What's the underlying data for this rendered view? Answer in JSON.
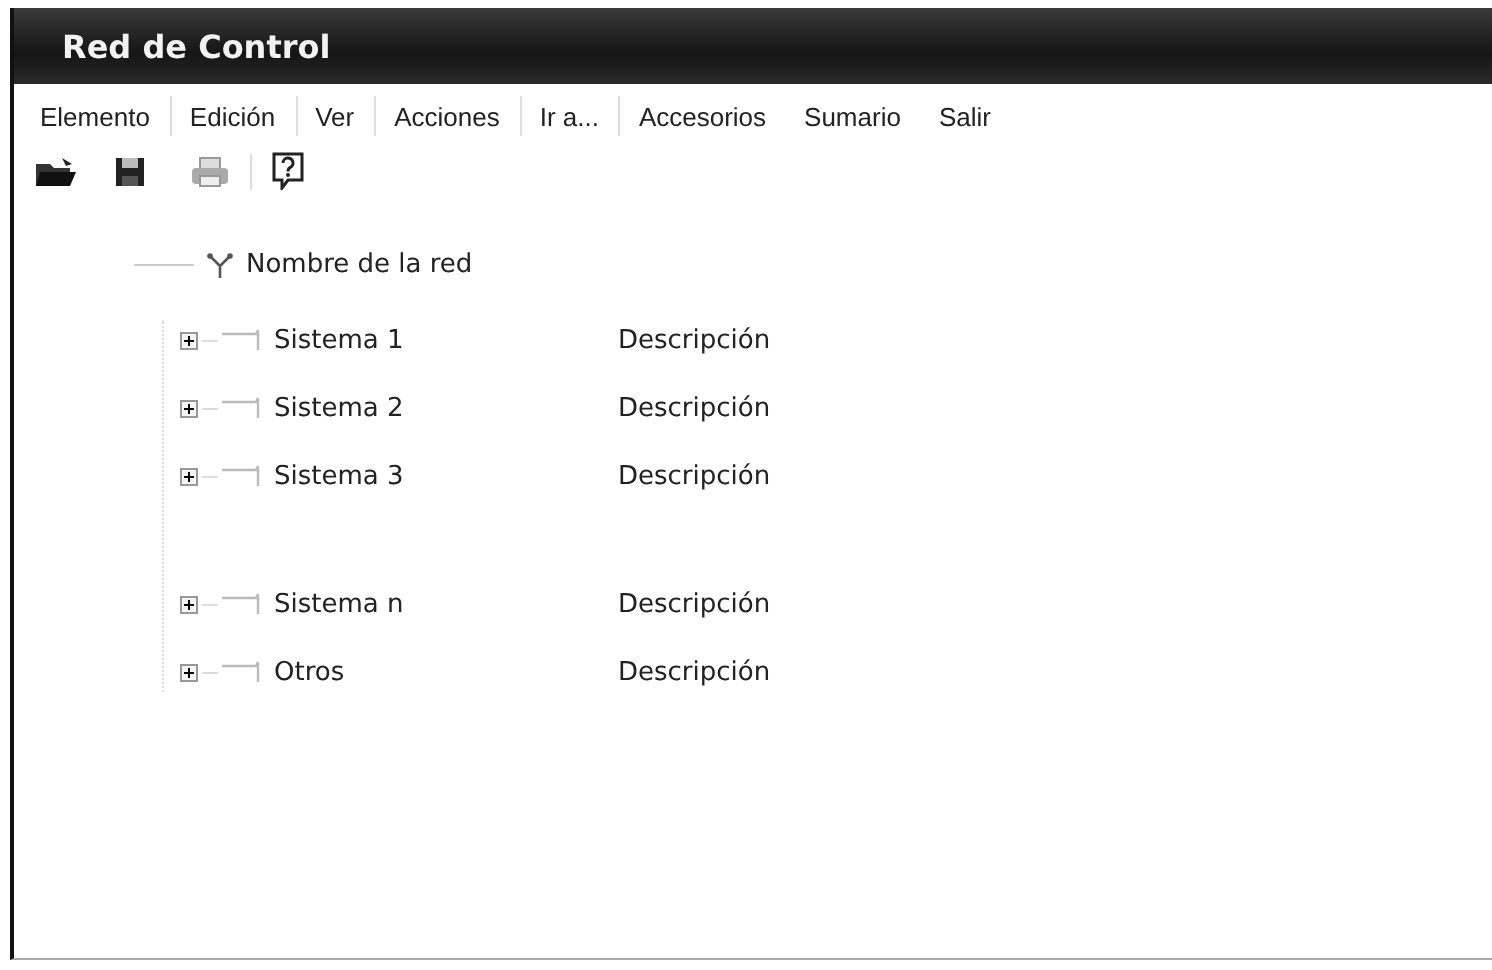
{
  "window": {
    "title": "Red de Control"
  },
  "menu": [
    "Elemento",
    "Edición",
    "Ver",
    "Acciones",
    "Ir a...",
    "Accesorios",
    "Sumario",
    "Salir"
  ],
  "tree": {
    "label": "Nombre de la red",
    "children": [
      {
        "label": "Sistema 1",
        "description": "Descripción",
        "expanded": false
      },
      {
        "label": "Sistema 2",
        "description": "Descripción",
        "expanded": false
      },
      {
        "label": "Sistema 3",
        "description": "Descripción",
        "expanded": false
      },
      {
        "label": "Sistema n",
        "description": "Descripción",
        "expanded": false
      },
      {
        "label": "Otros",
        "description": "Descripción",
        "expanded": false
      }
    ]
  }
}
